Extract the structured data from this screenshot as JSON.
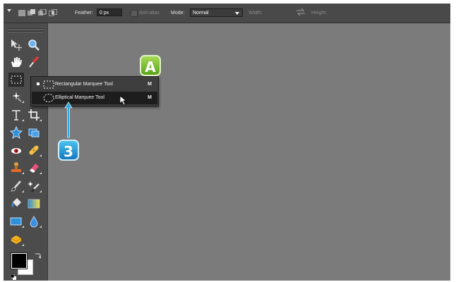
{
  "options_bar": {
    "feather_label": "Feather:",
    "feather_value": "0 px",
    "antialias_label": "Anti-alias",
    "mode_label": "Mode:",
    "mode_value": "Normal",
    "width_label": "Width:",
    "height_label": "Height:"
  },
  "flyout": {
    "items": [
      {
        "label": "Rectangular Marquee Tool",
        "shortcut": "M",
        "selected": false
      },
      {
        "label": "Elliptical Marquee Tool",
        "shortcut": "M",
        "selected": true
      }
    ]
  },
  "callouts": {
    "a": "A",
    "step": "3"
  },
  "colors": {
    "workspace": "#7b7b7b",
    "options_bar": "#494949",
    "toolbox": "#4c4c4c",
    "callout_green": "#7cc234",
    "callout_blue": "#2aa3df"
  },
  "tools": [
    "move-icon",
    "zoom-icon",
    "hand-icon",
    "eyedropper-icon",
    "marquee-icon",
    "magic-wand-icon",
    "type-icon",
    "crop-icon",
    "cookie-cutter-icon",
    "straighten-icon",
    "red-eye-icon",
    "healing-brush-icon",
    "clone-stamp-icon",
    "eraser-icon",
    "brush-icon",
    "smart-brush-icon",
    "paint-bucket-icon",
    "gradient-icon",
    "shape-icon",
    "blur-icon",
    "sponge-icon"
  ]
}
